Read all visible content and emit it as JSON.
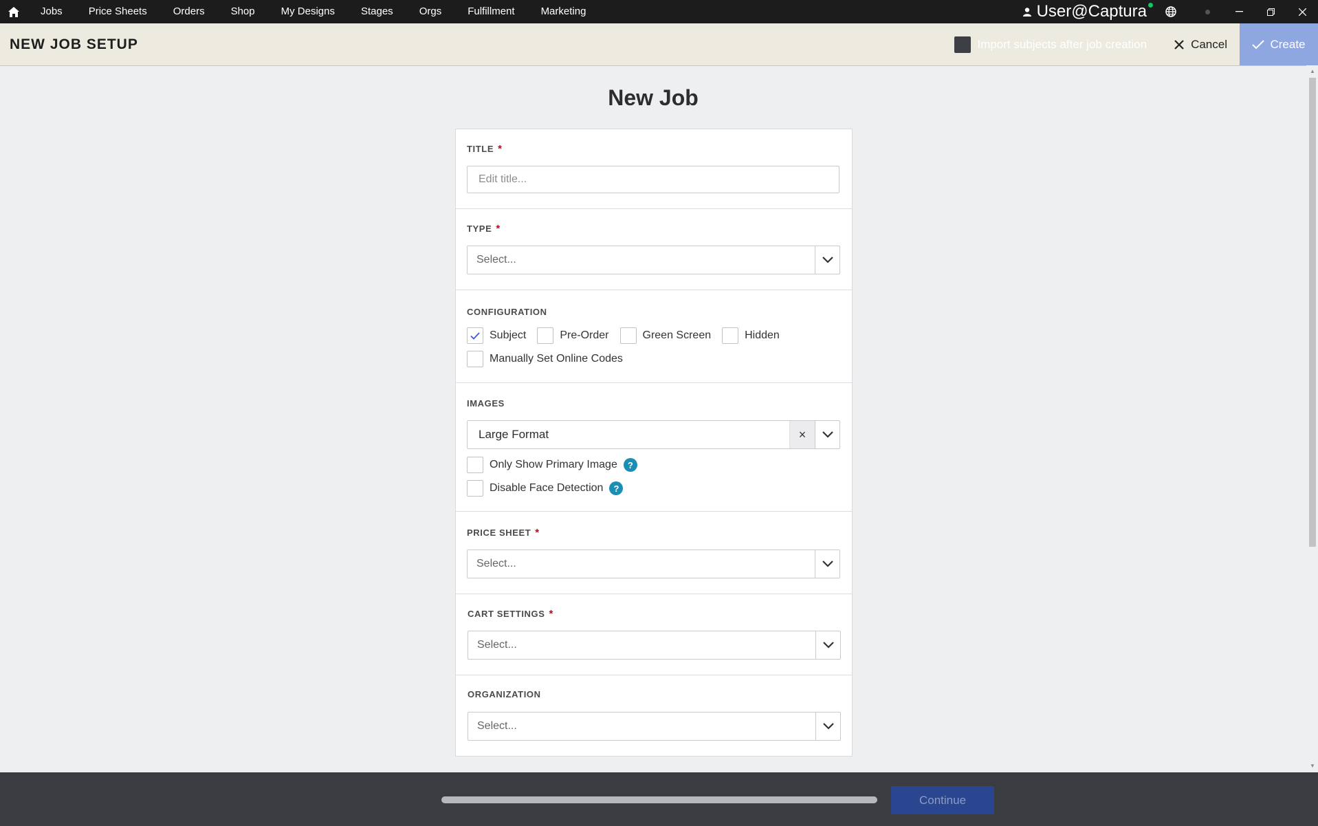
{
  "nav": {
    "items": [
      {
        "label": "Jobs"
      },
      {
        "label": "Price Sheets"
      },
      {
        "label": "Orders"
      },
      {
        "label": "Shop"
      },
      {
        "label": "My Designs"
      },
      {
        "label": "Stages"
      },
      {
        "label": "Orgs"
      },
      {
        "label": "Fulfillment"
      },
      {
        "label": "Marketing"
      }
    ],
    "user_name": "User@Captura",
    "online_status_color": "#16c466"
  },
  "header": {
    "title": "NEW JOB SETUP",
    "import_label": "Import subjects after job creation",
    "cancel_label": "Cancel",
    "create_label": "Create"
  },
  "form": {
    "heading": "New Job",
    "title": {
      "label": "TITLE",
      "required_mark": "*",
      "placeholder": "Edit title..."
    },
    "type": {
      "label": "TYPE",
      "required_mark": "*",
      "value": "Select..."
    },
    "configuration": {
      "label": "CONFIGURATION",
      "options": [
        {
          "label": "Subject",
          "checked": true
        },
        {
          "label": "Pre-Order",
          "checked": false
        },
        {
          "label": "Green Screen",
          "checked": false
        },
        {
          "label": "Hidden",
          "checked": false
        },
        {
          "label": "Manually Set Online Codes",
          "checked": false
        }
      ]
    },
    "images": {
      "label": "IMAGES",
      "value": "Large Format",
      "clear_symbol": "×",
      "options": [
        {
          "label": "Only Show Primary Image",
          "checked": false,
          "help": "?"
        },
        {
          "label": "Disable Face Detection",
          "checked": false,
          "help": "?"
        }
      ]
    },
    "price_sheet": {
      "label": "PRICE SHEET",
      "required_mark": "*",
      "value": "Select..."
    },
    "cart_settings": {
      "label": "CART SETTINGS",
      "required_mark": "*",
      "value": "Select..."
    },
    "organization": {
      "label": "ORGANIZATION",
      "value": "Select..."
    }
  },
  "footer": {
    "progress": 1.0,
    "continue_label": "Continue"
  },
  "colors": {
    "create_button": "#8fa7e0",
    "continue_button": "#2a4690",
    "required": "#d0021b",
    "help_icon": "#1b8fb3",
    "check": "#3b5bdb"
  }
}
